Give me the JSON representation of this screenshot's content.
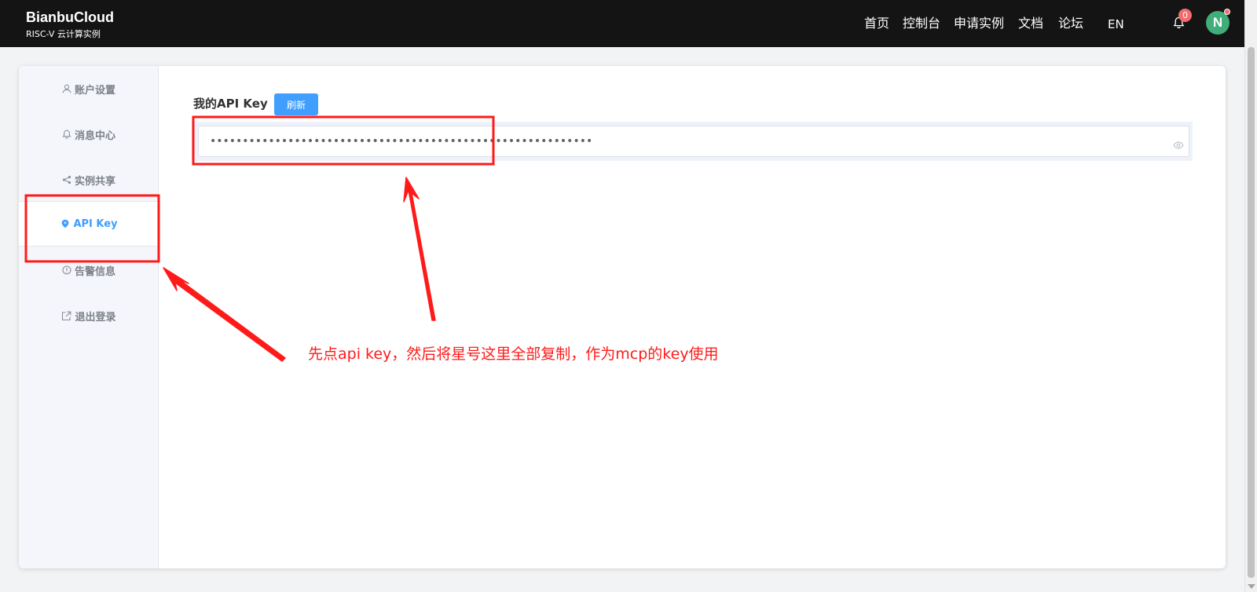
{
  "brand": {
    "title": "BianbuCloud",
    "subtitle": "RISC-V 云计算实例"
  },
  "nav": {
    "items": [
      "首页",
      "控制台",
      "申请实例",
      "文档",
      "论坛",
      "EN"
    ],
    "notification_count": "0",
    "avatar_initial": "N"
  },
  "sidebar": {
    "items": [
      {
        "label": "账户设置",
        "icon": "user-icon"
      },
      {
        "label": "消息中心",
        "icon": "bell-icon"
      },
      {
        "label": "实例共享",
        "icon": "share-icon"
      },
      {
        "label": "API Key",
        "icon": "key-icon",
        "active": true
      },
      {
        "label": "告警信息",
        "icon": "warning-icon"
      },
      {
        "label": "退出登录",
        "icon": "logout-icon"
      }
    ]
  },
  "main": {
    "key_label": "我的API Key",
    "refresh_label": "刷新",
    "key_value": "•••••••••••••••••••••••••••••••••••••••••••••••••••••••••••"
  },
  "annotation": {
    "text": "先点api key，然后将星号这里全部复制，作为mcp的key使用"
  },
  "colors": {
    "navbar": "#141414",
    "accent": "#409eff",
    "badge": "#f56c6c",
    "avatar": "#3fae7a",
    "annotation": "#ff1a1a"
  }
}
